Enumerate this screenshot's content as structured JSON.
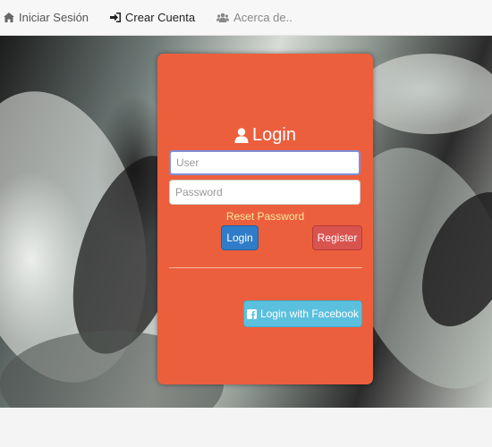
{
  "nav": {
    "items": [
      {
        "label": "Iniciar Sesión",
        "icon": "home-icon"
      },
      {
        "label": "Crear Cuenta",
        "icon": "sign-in-icon"
      },
      {
        "label": "Acerca de..",
        "icon": "users-icon"
      }
    ]
  },
  "login": {
    "title": "Login",
    "user_placeholder": "User",
    "password_placeholder": "Password",
    "reset_label": "Reset Password",
    "login_button": "Login",
    "register_button": "Register",
    "facebook_button": "Login with Facebook"
  },
  "colors": {
    "card": "#ec5f3d",
    "login_button": "#2f7dc9",
    "register_button": "#d9534f",
    "facebook_button": "#5bc0de",
    "reset_link": "#f9e99a"
  }
}
